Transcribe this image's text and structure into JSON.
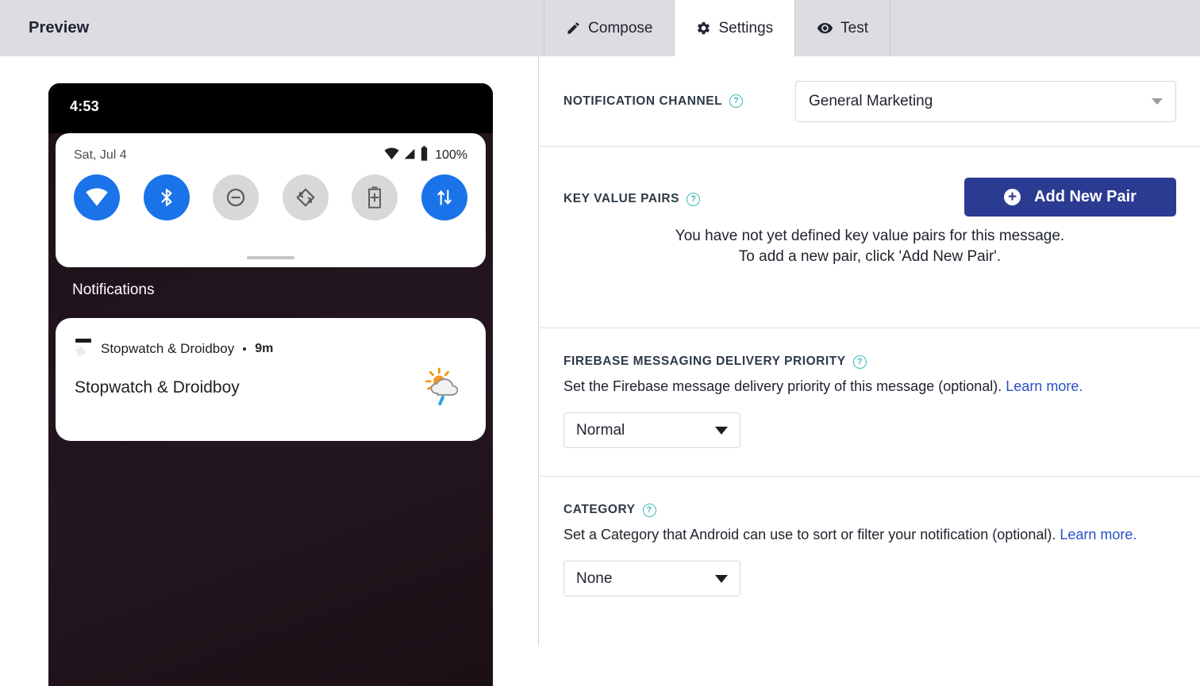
{
  "header": {
    "title": "Preview",
    "tabs": [
      {
        "label": "Compose",
        "icon": "pencil-icon",
        "active": false
      },
      {
        "label": "Settings",
        "icon": "gear-icon",
        "active": true
      },
      {
        "label": "Test",
        "icon": "eye-icon",
        "active": false
      }
    ]
  },
  "preview": {
    "status_time": "4:53",
    "quick_settings": {
      "date": "Sat, Jul 4",
      "battery_percent": "100%",
      "toggles": [
        {
          "name": "wifi-toggle",
          "state": "on"
        },
        {
          "name": "bluetooth-toggle",
          "state": "on"
        },
        {
          "name": "do-not-disturb-toggle",
          "state": "off"
        },
        {
          "name": "auto-rotate-toggle",
          "state": "off"
        },
        {
          "name": "battery-saver-toggle",
          "state": "off"
        },
        {
          "name": "mobile-data-toggle",
          "state": "on"
        }
      ]
    },
    "notifications_label": "Notifications",
    "notification": {
      "app_name": "Stopwatch & Droidboy",
      "time": "9m",
      "title": "Stopwatch & Droidboy",
      "icon": "weather-sun-cloud-rain-icon"
    }
  },
  "settings": {
    "notification_channel": {
      "label": "NOTIFICATION CHANNEL",
      "help": "?",
      "value": "General Marketing"
    },
    "key_value_pairs": {
      "label": "KEY VALUE PAIRS",
      "help": "?",
      "add_button": "Add New Pair",
      "empty_line1": "You have not yet defined key value pairs for this message.",
      "empty_line2": "To add a new pair, click 'Add New Pair'."
    },
    "delivery_priority": {
      "label": "FIREBASE MESSAGING DELIVERY PRIORITY",
      "help": "?",
      "description": "Set the Firebase message delivery priority of this message (optional).",
      "link": "Learn more.",
      "value": "Normal"
    },
    "category": {
      "label": "CATEGORY",
      "help": "?",
      "description": "Set a Category that Android can use to sort or filter your notification (optional).",
      "link": "Learn more.",
      "value": "None"
    }
  },
  "colors": {
    "topbar_bg": "#dcdce1",
    "accent_button": "#2b3b91",
    "help_icon": "#3eb8b8",
    "link": "#2b4fc7",
    "toggle_on": "#1a73e8"
  }
}
